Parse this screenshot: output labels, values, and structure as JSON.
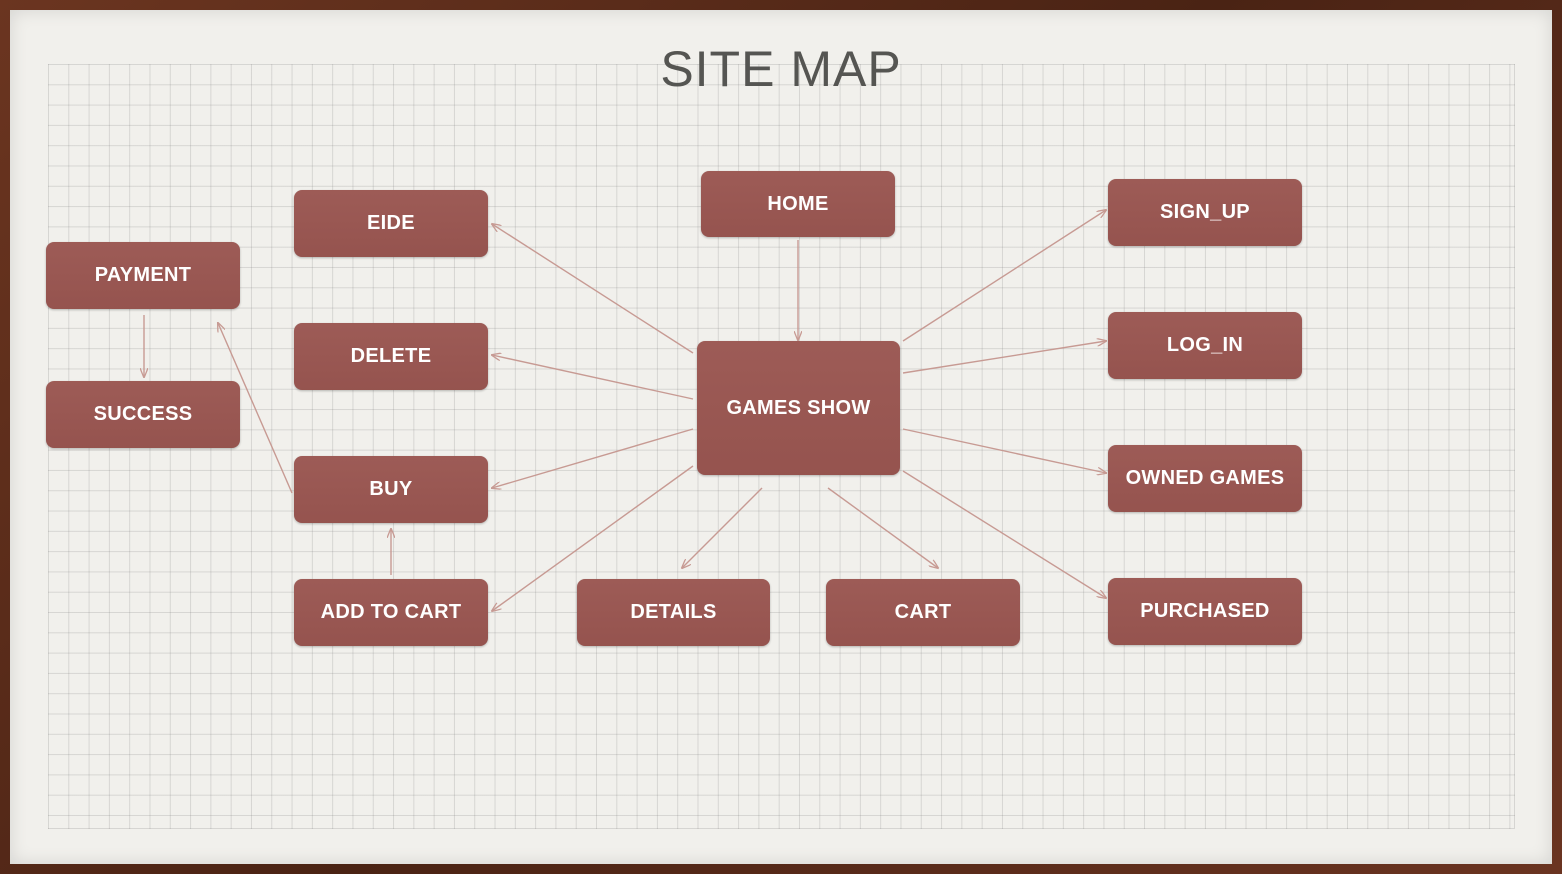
{
  "title": "SITE MAP",
  "colors": {
    "node": "#9a5651",
    "arrow": "#c79a93",
    "paper": "#f1f0ec",
    "frame": "#5a2e1e"
  },
  "nodes": {
    "home": "HOME",
    "games_show": "GAMES SHOW",
    "eide": "EIDE",
    "delete": "DELETE",
    "buy": "BUY",
    "add_to_cart": "ADD TO CART",
    "payment": "PAYMENT",
    "success": "SUCCESS",
    "details": "DETAILS",
    "cart": "CART",
    "sign_up": "SIGN_UP",
    "log_in": "LOG_IN",
    "owned_games": "OWNED GAMES",
    "purchased": "PURCHASED"
  },
  "edges": [
    [
      "home",
      "games_show"
    ],
    [
      "games_show",
      "eide"
    ],
    [
      "games_show",
      "delete"
    ],
    [
      "games_show",
      "buy"
    ],
    [
      "games_show",
      "add_to_cart"
    ],
    [
      "games_show",
      "details"
    ],
    [
      "games_show",
      "cart"
    ],
    [
      "games_show",
      "sign_up"
    ],
    [
      "games_show",
      "log_in"
    ],
    [
      "games_show",
      "owned_games"
    ],
    [
      "games_show",
      "purchased"
    ],
    [
      "add_to_cart",
      "buy"
    ],
    [
      "buy",
      "payment"
    ],
    [
      "payment",
      "success"
    ]
  ]
}
